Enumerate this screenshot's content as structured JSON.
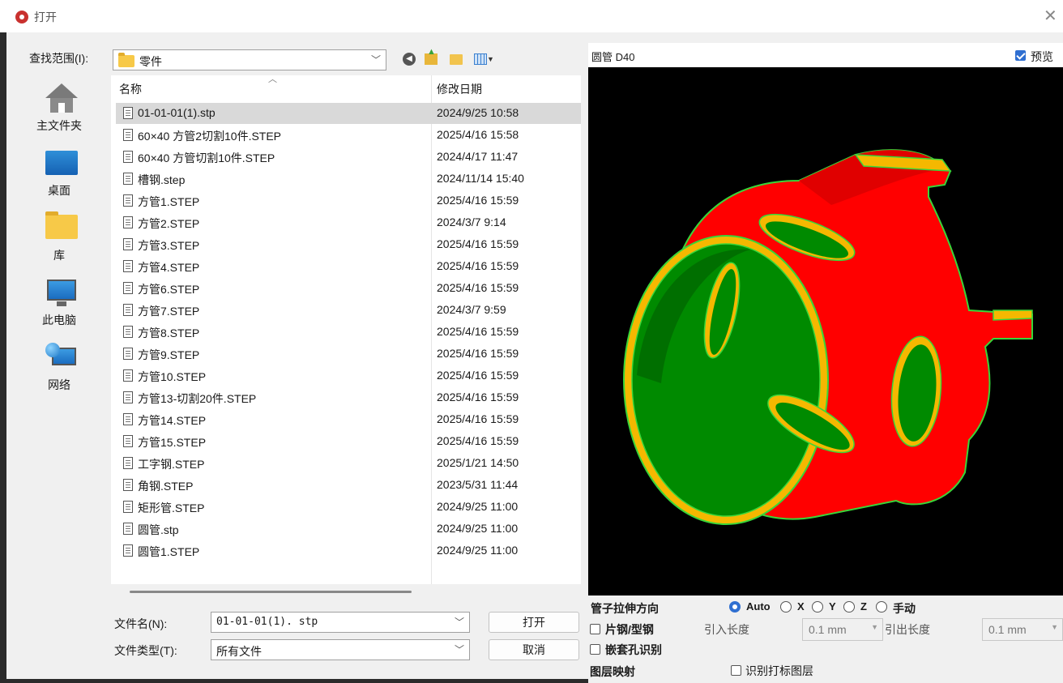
{
  "window": {
    "title": "打开",
    "close_glyph": "✕"
  },
  "lookin": {
    "label": "查找范围(I):",
    "value": "零件"
  },
  "toolbar": {
    "back_icon": "back-icon",
    "up_icon": "up-folder-icon",
    "new_icon": "new-folder-icon",
    "view_icon": "view-menu-icon"
  },
  "places": [
    {
      "label": "主文件夹",
      "icon": "home-icon"
    },
    {
      "label": "桌面",
      "icon": "desktop-icon"
    },
    {
      "label": "库",
      "icon": "folder-icon"
    },
    {
      "label": "此电脑",
      "icon": "computer-icon"
    },
    {
      "label": "网络",
      "icon": "network-icon"
    }
  ],
  "filelist": {
    "col_name": "名称",
    "col_date": "修改日期",
    "files": [
      {
        "name": "01-01-01(1).stp",
        "date": "2024/9/25 10:58"
      },
      {
        "name": "60×40 方管2切割10件.STEP",
        "date": "2025/4/16 15:58"
      },
      {
        "name": "60×40 方管切割10件.STEP",
        "date": "2024/4/17 11:47"
      },
      {
        "name": "槽钢.step",
        "date": "2024/11/14 15:40"
      },
      {
        "name": "方管1.STEP",
        "date": "2025/4/16 15:59"
      },
      {
        "name": "方管2.STEP",
        "date": "2024/3/7 9:14"
      },
      {
        "name": "方管3.STEP",
        "date": "2025/4/16 15:59"
      },
      {
        "name": "方管4.STEP",
        "date": "2025/4/16 15:59"
      },
      {
        "name": "方管6.STEP",
        "date": "2025/4/16 15:59"
      },
      {
        "name": "方管7.STEP",
        "date": "2024/3/7 9:59"
      },
      {
        "name": "方管8.STEP",
        "date": "2025/4/16 15:59"
      },
      {
        "name": "方管9.STEP",
        "date": "2025/4/16 15:59"
      },
      {
        "name": "方管10.STEP",
        "date": "2025/4/16 15:59"
      },
      {
        "name": "方管13-切割20件.STEP",
        "date": "2025/4/16 15:59"
      },
      {
        "name": "方管14.STEP",
        "date": "2025/4/16 15:59"
      },
      {
        "name": "方管15.STEP",
        "date": "2025/4/16 15:59"
      },
      {
        "name": "工字钢.STEP",
        "date": "2025/1/21 14:50"
      },
      {
        "name": "角钢.STEP",
        "date": "2023/5/31 11:44"
      },
      {
        "name": "矩形管.STEP",
        "date": "2024/9/25 11:00"
      },
      {
        "name": "圆管.stp",
        "date": "2024/9/25 11:00"
      },
      {
        "name": "圆管1.STEP",
        "date": "2024/9/25 11:00"
      }
    ]
  },
  "filename": {
    "label": "文件名(N):",
    "value": "01-01-01(1). stp"
  },
  "filetype": {
    "label": "文件类型(T):",
    "value": "所有文件"
  },
  "buttons": {
    "open": "打开",
    "cancel": "取消"
  },
  "preview": {
    "title": "圆管 D40",
    "check_label": "预览",
    "check_on": true,
    "colors": {
      "outer": "#ff0000",
      "inner": "#008a00",
      "edge": "#f5b800",
      "outline": "#39d639",
      "bg": "#000000"
    }
  },
  "options": {
    "direction_label": "管子拉伸方向",
    "radios": [
      "Auto",
      "X",
      "Y",
      "Z",
      "手动"
    ],
    "radio_selected": "Auto",
    "profile_label": "片钢/型钢",
    "lead_in_label": "引入长度",
    "lead_in_value": "0.1 mm",
    "lead_out_label": "引出长度",
    "lead_out_value": "0.1 mm",
    "nest_hole_label": "嵌套孔识别",
    "layer_map_label": "图层映射",
    "mark_layer_label": "识别打标图层"
  }
}
